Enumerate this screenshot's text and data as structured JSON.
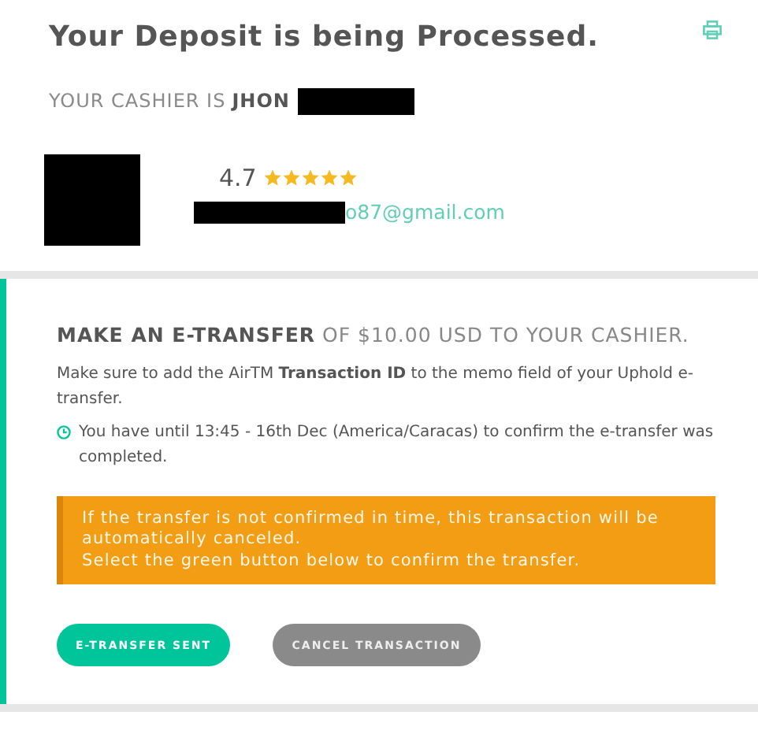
{
  "header": {
    "title": "Your Deposit is being Processed.",
    "cashier_label": "YOUR CASHIER IS",
    "cashier_name": "JHON"
  },
  "cashier": {
    "rating": "4.7",
    "stars": 5,
    "email": "o87@gmail.com"
  },
  "instructions": {
    "heading": "MAKE AN E-TRANSFER",
    "heading_rest": "OF $10.00 USD TO YOUR CASHIER.",
    "memo_note": "Make sure to add the AirTM **Transaction ID** to the memo field of your Uphold e-transfer.",
    "deadline": "You have until 13:45 - 16th Dec (America/Caracas) to confirm the e-transfer was completed.",
    "warning": [
      "If the transfer is not confirmed in time, this transaction will be automatically canceled.",
      "Select the green button below to confirm the transfer."
    ]
  },
  "buttons": [
    {
      "label": "E-TRANSFER SENT",
      "kind": "primary"
    },
    {
      "label": "CANCEL TRANSACTION",
      "kind": "secondary"
    }
  ]
}
